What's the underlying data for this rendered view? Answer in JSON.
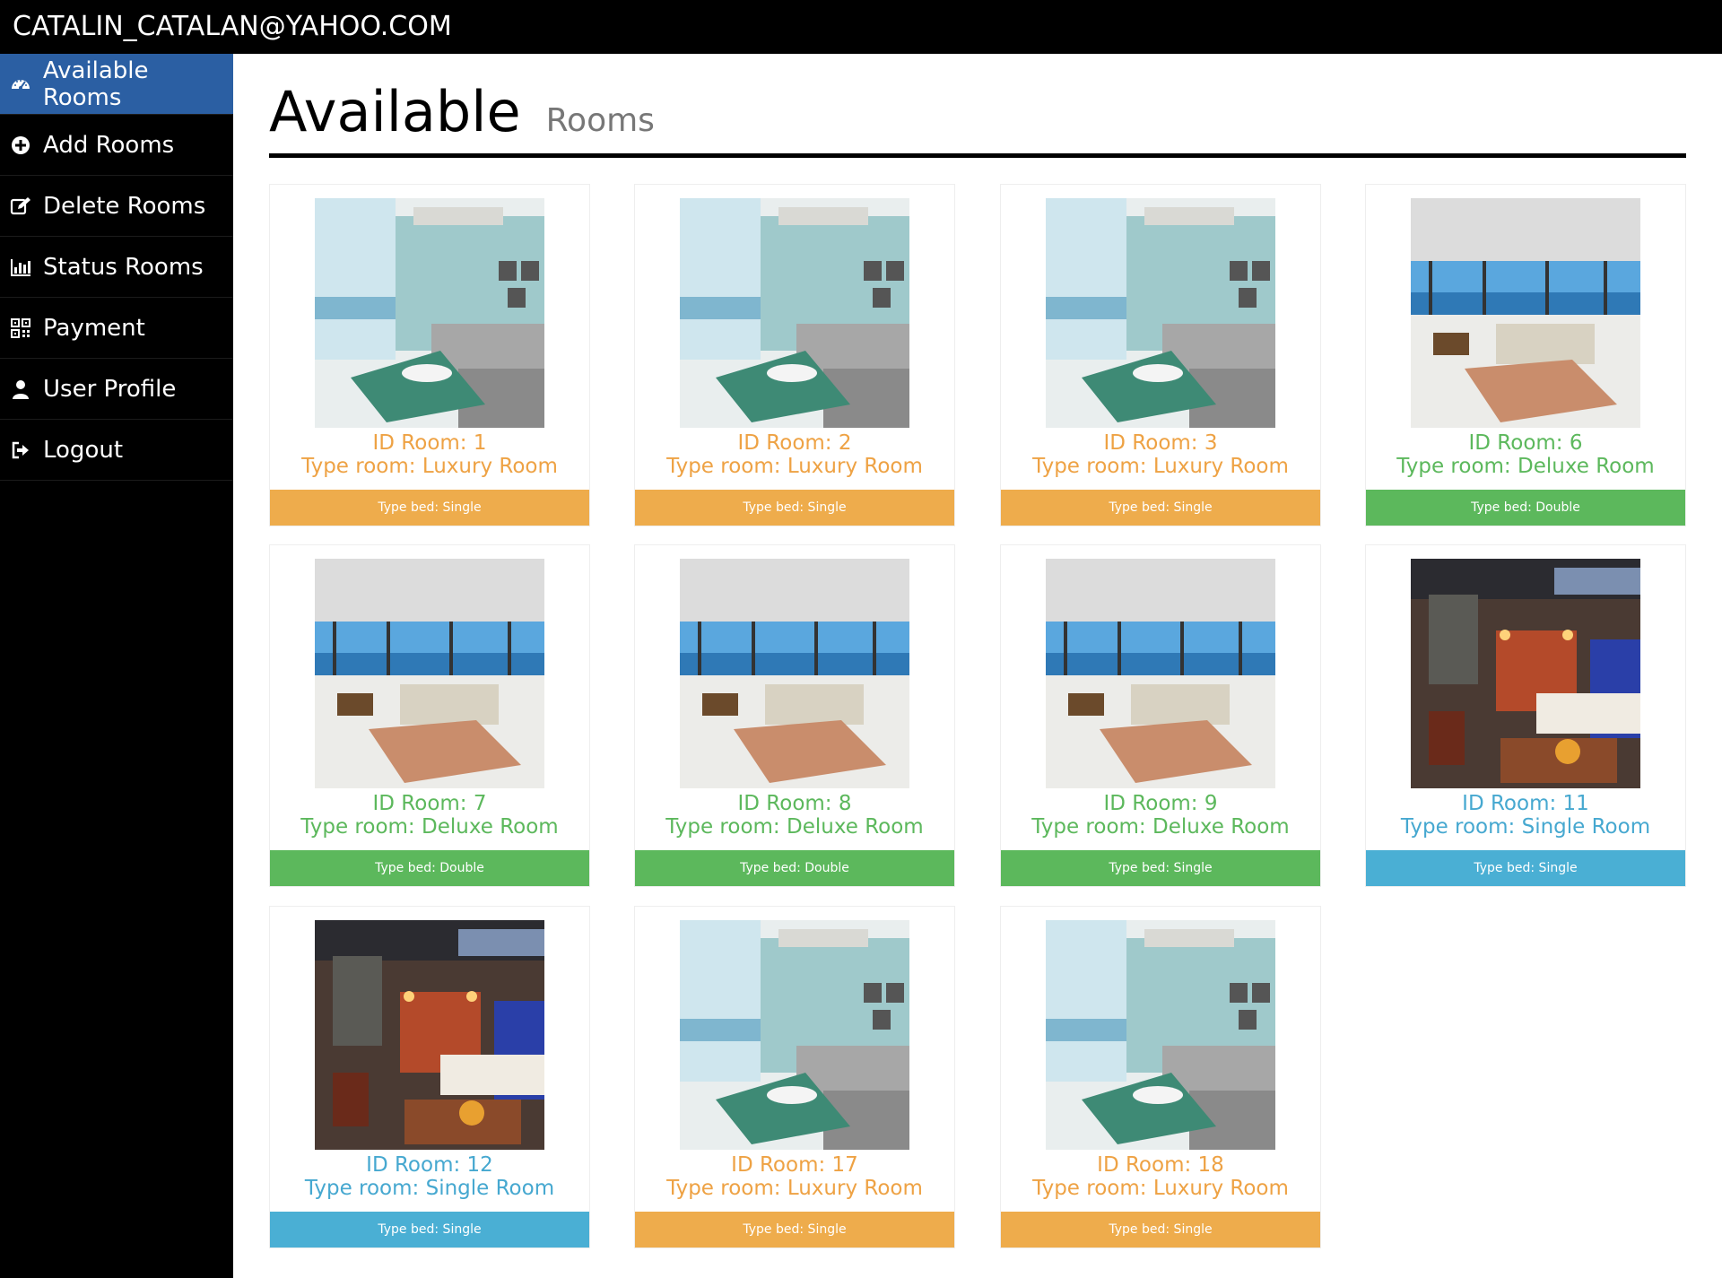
{
  "user_email": "CATALIN_CATALAN@YAHOO.COM",
  "nav": [
    {
      "label": "Available Rooms",
      "icon": "dashboard-icon"
    },
    {
      "label": "Add Rooms",
      "icon": "plus-circle-icon"
    },
    {
      "label": "Delete Rooms",
      "icon": "edit-icon"
    },
    {
      "label": "Status Rooms",
      "icon": "bar-chart-icon"
    },
    {
      "label": "Payment",
      "icon": "qrcode-icon"
    },
    {
      "label": "User Profile",
      "icon": "user-icon"
    },
    {
      "label": "Logout",
      "icon": "logout-icon"
    }
  ],
  "page": {
    "title": "Available",
    "subtitle": "Rooms"
  },
  "rooms": [
    {
      "id": "ID Room: 1",
      "type": "Type room: Luxury Room",
      "bed": "Type bed: Single"
    },
    {
      "id": "ID Room: 2",
      "type": "Type room: Luxury Room",
      "bed": "Type bed: Single"
    },
    {
      "id": "ID Room: 3",
      "type": "Type room: Luxury Room",
      "bed": "Type bed: Single"
    },
    {
      "id": "ID Room: 6",
      "type": "Type room: Deluxe Room",
      "bed": "Type bed: Double"
    },
    {
      "id": "ID Room: 7",
      "type": "Type room: Deluxe Room",
      "bed": "Type bed: Double"
    },
    {
      "id": "ID Room: 8",
      "type": "Type room: Deluxe Room",
      "bed": "Type bed: Double"
    },
    {
      "id": "ID Room: 9",
      "type": "Type room: Deluxe Room",
      "bed": "Type bed: Single"
    },
    {
      "id": "ID Room: 11",
      "type": "Type room: Single Room",
      "bed": "Type bed: Single"
    },
    {
      "id": "ID Room: 12",
      "type": "Type room: Single Room",
      "bed": "Type bed: Single"
    },
    {
      "id": "ID Room: 17",
      "type": "Type room: Luxury Room",
      "bed": "Type bed: Single"
    },
    {
      "id": "ID Room: 18",
      "type": "Type room: Luxury Room",
      "bed": "Type bed: Single"
    }
  ],
  "colors": {
    "topbar": "#000000",
    "sidebar": "#000000",
    "active_nav": "#2b5fa3",
    "luxury": "#eeac4c",
    "deluxe": "#5cb85c",
    "single": "#4aafd4"
  }
}
